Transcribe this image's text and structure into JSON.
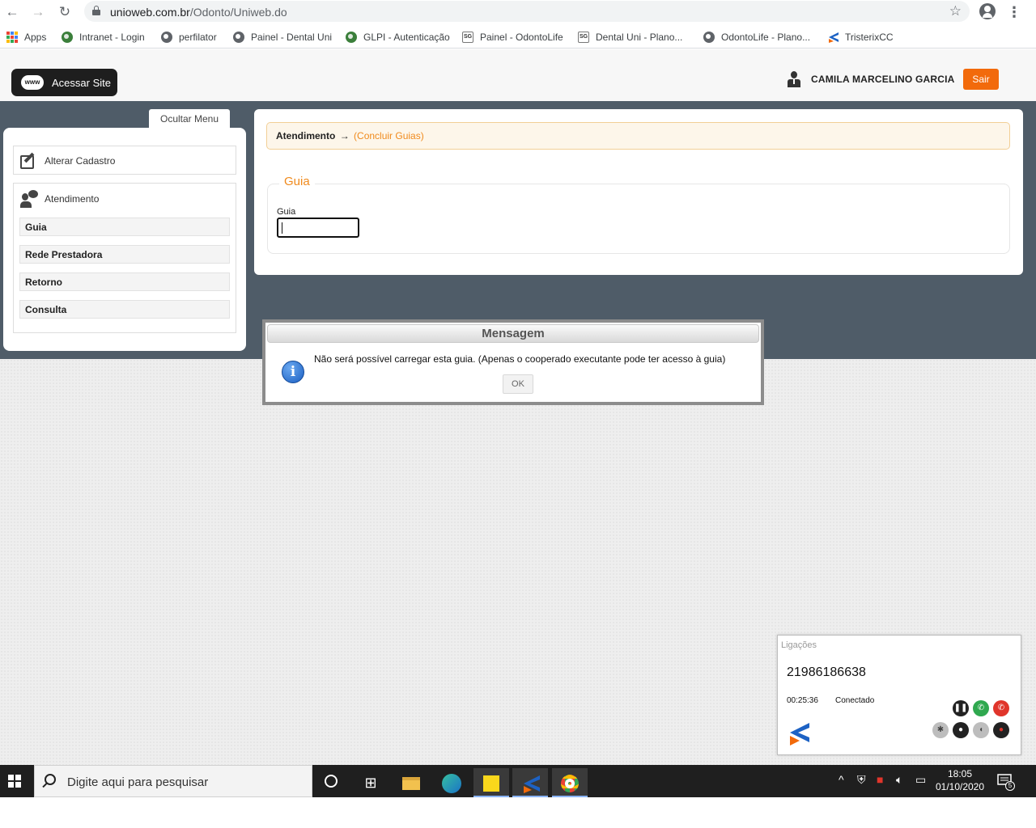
{
  "browser": {
    "url_domain": "unioweb.com.br",
    "url_path": "/Odonto/Uniweb.do",
    "bookmarks": [
      {
        "label": "Apps",
        "icon": "apps-grid-icon"
      },
      {
        "label": "Intranet - Login",
        "icon": "globe-icon"
      },
      {
        "label": "perfilator",
        "icon": "globe-icon"
      },
      {
        "label": "Painel - Dental Uni",
        "icon": "globe-icon"
      },
      {
        "label": "GLPI - Autenticação",
        "icon": "glpi-icon"
      },
      {
        "label": "Painel - OdontoLife",
        "icon": "sg-icon"
      },
      {
        "label": "Dental Uni - Plano...",
        "icon": "sg-icon"
      },
      {
        "label": "OdontoLife - Plano...",
        "icon": "globe-icon"
      },
      {
        "label": "TristerixCC",
        "icon": "tristerix-icon"
      }
    ]
  },
  "header": {
    "site_button": "Acessar Site",
    "www_badge": "www",
    "user_name": "CAMILA MARCELINO GARCIA",
    "logout": "Sair",
    "accent_color": "#f26a0b"
  },
  "sidebar": {
    "toggle_label": "Ocultar Menu",
    "alterar": "Alterar Cadastro",
    "atendimento": "Atendimento",
    "items": [
      "Guia",
      "Rede Prestadora",
      "Retorno",
      "Consulta"
    ]
  },
  "main": {
    "breadcrumb_main": "Atendimento",
    "breadcrumb_arrow": "→",
    "breadcrumb_sub": "(Concluir Guias)",
    "section_title": "Guia",
    "field_label": "Guia",
    "field_value": ""
  },
  "dialog": {
    "title": "Mensagem",
    "message": "Não será possível carregar esta guia. (Apenas o cooperado executante pode ter acesso à guia)",
    "ok": "OK",
    "info_glyph": "i"
  },
  "softphone": {
    "title": "Ligações",
    "number": "21986186638",
    "time": "00:25:36",
    "status": "Conectado"
  },
  "taskbar": {
    "search_placeholder": "Digite aqui para pesquisar",
    "time": "18:05",
    "date": "01/10/2020",
    "notification_count": "5"
  }
}
